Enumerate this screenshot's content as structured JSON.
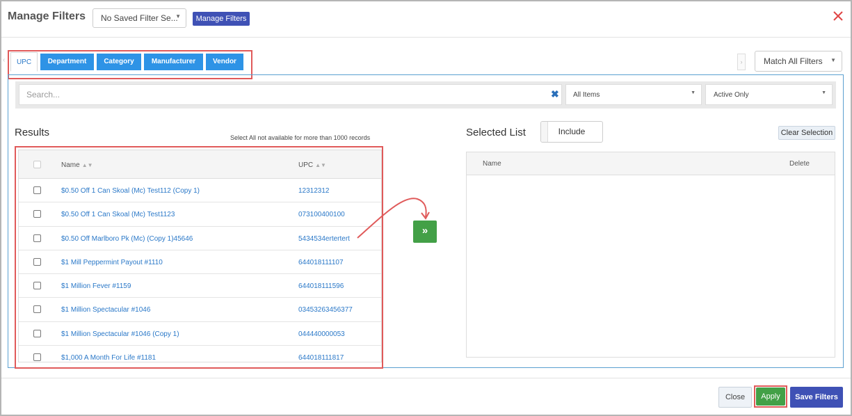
{
  "header": {
    "title": "Manage Filters",
    "saved_filter": "No Saved Filter Se...",
    "manage_filters_btn": "Manage Filters"
  },
  "tabs": [
    {
      "label": "UPC"
    },
    {
      "label": "Department"
    },
    {
      "label": "Category"
    },
    {
      "label": "Manufacturer"
    },
    {
      "label": "Vendor"
    }
  ],
  "match_select": "Match All Filters",
  "search": {
    "placeholder": "Search..."
  },
  "item_filter": "All Items",
  "status_filter": "Active Only",
  "results": {
    "title": "Results",
    "note": "Select All not available for more than 1000 records",
    "columns": {
      "name": "Name",
      "upc": "UPC"
    },
    "rows": [
      {
        "name": "$0.50 Off 1 Can Skoal (Mc) Test112 (Copy 1)",
        "upc": "12312312"
      },
      {
        "name": "$0.50 Off 1 Can Skoal (Mc) Test1123",
        "upc": "073100400100"
      },
      {
        "name": "$0.50 Off Marlboro Pk (Mc) (Copy 1)45646",
        "upc": "5434534ertertert"
      },
      {
        "name": "$1 Mill Peppermint Payout #1110",
        "upc": "644018111107"
      },
      {
        "name": "$1 Million Fever #1159",
        "upc": "644018111596"
      },
      {
        "name": "$1 Million Spectacular #1046",
        "upc": "03453263456377"
      },
      {
        "name": "$1 Million Spectacular #1046 (Copy 1)",
        "upc": "044440000053"
      },
      {
        "name": "$1,000 A Month For Life #1181",
        "upc": "644018111817"
      }
    ]
  },
  "move_btn": "»",
  "selected": {
    "title": "Selected List",
    "include": "Include",
    "clear": "Clear Selection",
    "columns": {
      "name": "Name",
      "delete": "Delete"
    }
  },
  "footer": {
    "close": "Close",
    "apply": "Apply",
    "save": "Save Filters"
  },
  "colors": {
    "primary": "#3f51b5",
    "tab": "#2e93e6",
    "success": "#43a047",
    "highlight": "#e05a5a"
  }
}
